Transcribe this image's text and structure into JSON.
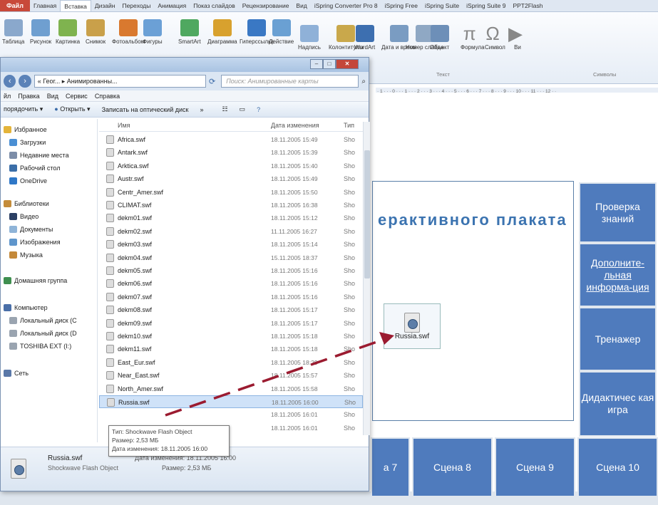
{
  "ribbon": {
    "file_tab": "Файл",
    "tabs": [
      "Главная",
      "Вставка",
      "Дизайн",
      "Переходы",
      "Анимация",
      "Показ слайдов",
      "Рецензирование",
      "Вид",
      "iSpring Converter Pro 8",
      "iSpring Free",
      "iSpring Suite",
      "iSpring Suite 9",
      "PPT2Flash"
    ],
    "active_tab": "Вставка",
    "buttons": [
      {
        "label": "Таблица",
        "icon": "table-icon"
      },
      {
        "label": "Рисунок",
        "icon": "picture-icon"
      },
      {
        "label": "Картинка",
        "icon": "clipart-icon"
      },
      {
        "label": "Снимок",
        "icon": "screenshot-icon"
      },
      {
        "label": "Фотоальбом",
        "icon": "photoalbum-icon"
      },
      {
        "label": "Фигуры",
        "icon": "shapes-icon"
      },
      {
        "label": "SmartArt",
        "icon": "smartart-icon"
      },
      {
        "label": "Диаграмма",
        "icon": "chart-icon"
      },
      {
        "label": "Гиперссылка",
        "icon": "hyperlink-icon"
      },
      {
        "label": "Действие",
        "icon": "action-icon"
      },
      {
        "label": "Надпись",
        "icon": "textbox-icon"
      },
      {
        "label": "Колонтитулы",
        "icon": "header-footer-icon"
      },
      {
        "label": "WordArt",
        "icon": "wordart-icon"
      },
      {
        "label": "Дата и время",
        "icon": "datetime-icon"
      },
      {
        "label": "Номер слайда",
        "icon": "slide-number-icon"
      },
      {
        "label": "Объект",
        "icon": "object-icon"
      },
      {
        "label": "Формула",
        "icon": "formula-icon"
      },
      {
        "label": "Символ",
        "icon": "symbol-icon"
      },
      {
        "label": "Ви",
        "icon": "video-icon"
      }
    ],
    "group_text": "Текст",
    "group_symbols": "Символы",
    "ruler": "· 1 · · · 0 · · · 1 · · · 2 · · · 3 · · · 4 · · · 5 · · · 6 · · · 7 · · · 8 · · · 9 · · · 10 · · · 11 · · · 12 · ·"
  },
  "slide": {
    "title": "ерактивного плаката",
    "side_buttons": [
      "Проверка знаний",
      "Дополните-льная информа-ция",
      "Тренажер",
      "Дидактичес кая игра"
    ],
    "bottom_buttons": [
      "а 7",
      "Сцена 8",
      "Сцена 9",
      "Сцена 10"
    ],
    "dropped_file": "Russia.swf"
  },
  "explorer": {
    "breadcrumb": "« Геог... ▸ Анимированны...",
    "search_placeholder": "Поиск: Анимированные карты",
    "menu": [
      "йл",
      "Правка",
      "Вид",
      "Сервис",
      "Справка"
    ],
    "toolbar": {
      "organize": "порядочить ▾",
      "open": "Открыть ▾",
      "burn": "Записать на оптический диск",
      "more": "»"
    },
    "nav": [
      {
        "label": "Избранное",
        "icon": "star-icon"
      },
      {
        "label": "Загрузки",
        "icon": "downloads-icon"
      },
      {
        "label": "Недавние места",
        "icon": "recent-places-icon"
      },
      {
        "label": "Рабочий стол",
        "icon": "desktop-icon"
      },
      {
        "label": "OneDrive",
        "icon": "onedrive-icon"
      },
      {
        "label": "Библиотеки",
        "icon": "library-icon"
      },
      {
        "label": "Видео",
        "icon": "video-library-icon"
      },
      {
        "label": "Документы",
        "icon": "documents-icon"
      },
      {
        "label": "Изображения",
        "icon": "pictures-icon"
      },
      {
        "label": "Музыка",
        "icon": "music-icon"
      },
      {
        "label": "Домашняя группа",
        "icon": "homegroup-icon"
      },
      {
        "label": "Компьютер",
        "icon": "computer-icon"
      },
      {
        "label": "Локальный диск (C",
        "icon": "drive-icon"
      },
      {
        "label": "Локальный диск (D",
        "icon": "drive-icon"
      },
      {
        "label": "TOSHIBA EXT (I:)",
        "icon": "drive-icon"
      },
      {
        "label": "Сеть",
        "icon": "network-icon"
      }
    ],
    "columns": {
      "name": "Имя",
      "date": "Дата изменения",
      "type": "Тип"
    },
    "files": [
      {
        "name": "Africa.swf",
        "date": "18.11.2005 15:49",
        "type": "Sho"
      },
      {
        "name": "Antark.swf",
        "date": "18.11.2005 15:39",
        "type": "Sho"
      },
      {
        "name": "Arktica.swf",
        "date": "18.11.2005 15:40",
        "type": "Sho"
      },
      {
        "name": "Austr.swf",
        "date": "18.11.2005 15:49",
        "type": "Sho"
      },
      {
        "name": "Centr_Amer.swf",
        "date": "18.11.2005 15:50",
        "type": "Sho"
      },
      {
        "name": "CLIMAT.swf",
        "date": "18.11.2005 16:38",
        "type": "Sho"
      },
      {
        "name": "dekm01.swf",
        "date": "18.11.2005 15:12",
        "type": "Sho"
      },
      {
        "name": "dekm02.swf",
        "date": "11.11.2005 16:27",
        "type": "Sho"
      },
      {
        "name": "dekm03.swf",
        "date": "18.11.2005 15:14",
        "type": "Sho"
      },
      {
        "name": "dekm04.swf",
        "date": "15.11.2005 18:37",
        "type": "Sho"
      },
      {
        "name": "dekm05.swf",
        "date": "18.11.2005 15:16",
        "type": "Sho"
      },
      {
        "name": "dekm06.swf",
        "date": "18.11.2005 15:16",
        "type": "Sho"
      },
      {
        "name": "dekm07.swf",
        "date": "18.11.2005 15:16",
        "type": "Sho"
      },
      {
        "name": "dekm08.swf",
        "date": "18.11.2005 15:17",
        "type": "Sho"
      },
      {
        "name": "dekm09.swf",
        "date": "18.11.2005 15:17",
        "type": "Sho"
      },
      {
        "name": "dekm10.swf",
        "date": "18.11.2005 15:18",
        "type": "Sho"
      },
      {
        "name": "dekm11.swf",
        "date": "18.11.2005 15:18",
        "type": "Sho"
      },
      {
        "name": "East_Eur.swf",
        "date": "18.11.2005 18:29",
        "type": "Sho"
      },
      {
        "name": "Near_East.swf",
        "date": "18.11.2005 15:57",
        "type": "Sho"
      },
      {
        "name": "North_Amer.swf",
        "date": "18.11.2005 15:58",
        "type": "Sho"
      },
      {
        "name": "Russia.swf",
        "date": "18.11.2005 16:00",
        "type": "Sho"
      },
      {
        "name": "",
        "date": "18.11.2005 16:01",
        "type": "Sho"
      },
      {
        "name": "",
        "date": "18.11.2005 16:01",
        "type": "Sho"
      }
    ],
    "selected_file": "Russia.swf",
    "tooltip": {
      "type": "Тип: Shockwave Flash Object",
      "size": "Размер: 2,53 МБ",
      "date": "Дата изменения: 18.11.2005 16:00"
    },
    "status": {
      "name": "Russia.swf",
      "type": "Shockwave Flash Object",
      "date_label": "Дата изменения: 18.11.2005 16:00",
      "size_label": "Размер: 2,53 МБ"
    }
  },
  "colors": {
    "accent": "#4f7bbd",
    "arrow": "#9b1b30",
    "title": "#3b73b0"
  }
}
